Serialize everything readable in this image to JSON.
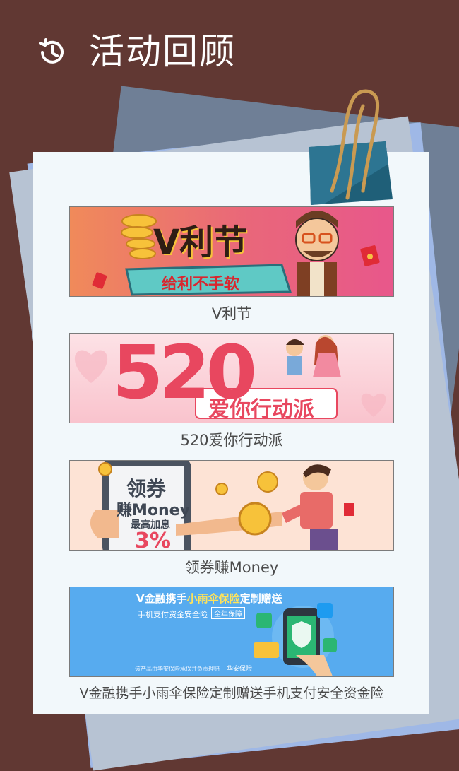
{
  "header": {
    "icon": "history-clock-icon",
    "title": "活动回顾"
  },
  "colors": {
    "background": "#613833",
    "card": "#f2f8fb",
    "caption": "#4a4a4a"
  },
  "activities": [
    {
      "caption": "V利节",
      "banner_title": "V利节",
      "banner_subtitle": "给利不手软"
    },
    {
      "caption": "520爱你行动派",
      "banner_number": "520",
      "banner_subtitle": "爱你行动派"
    },
    {
      "caption": "领券赚Money",
      "banner_line1": "领券",
      "banner_line2": "赚Money",
      "banner_line3": "最高加息",
      "banner_line4": "3%"
    },
    {
      "caption": "V金融携手小雨伞保险定制赠送手机支付安全资金险",
      "banner_title_part1": "V金融携手",
      "banner_title_part2": "小雨伞保险",
      "banner_title_part3": "定制赠送",
      "banner_subtitle": "手机支付资金安全险",
      "banner_badge": "全年保障",
      "banner_footnote": "该产品由华安保险承保并负责理赔",
      "banner_brand": "华安保险"
    }
  ]
}
